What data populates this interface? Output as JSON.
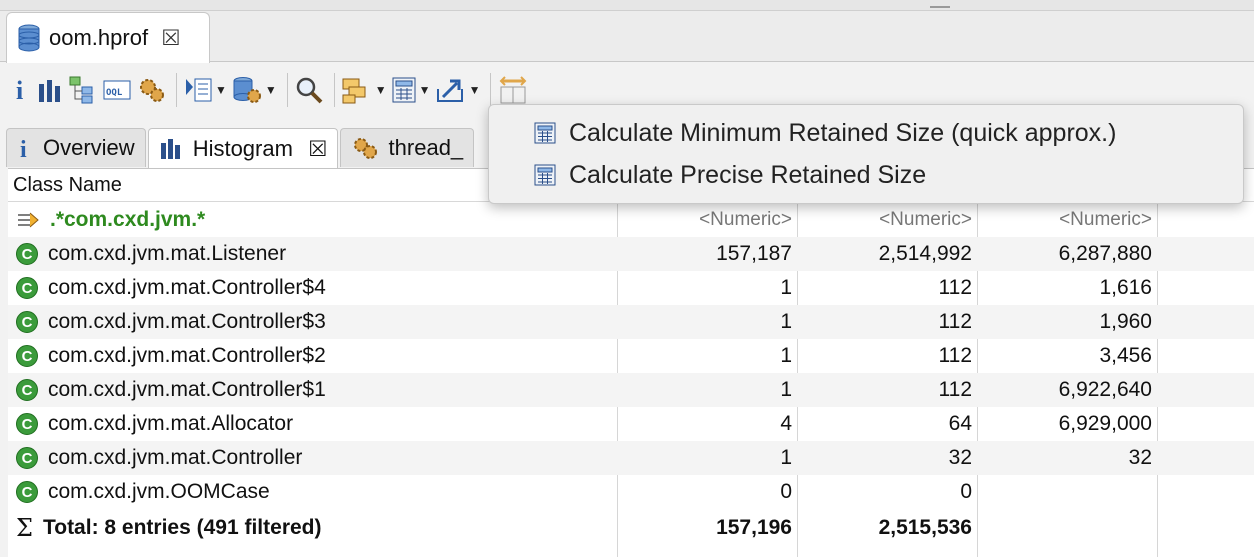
{
  "editor_tab": {
    "title": "oom.hprof"
  },
  "inner_tabs": [
    {
      "label": "Overview"
    },
    {
      "label": "Histogram"
    },
    {
      "label": "thread_"
    }
  ],
  "table": {
    "header": {
      "class_name": "Class Name"
    },
    "filter_row": {
      "name": ".*com.cxd.jvm.*",
      "c1": "<Numeric>",
      "c2": "<Numeric>",
      "c3": "<Numeric>"
    },
    "rows": [
      {
        "name": "com.cxd.jvm.mat.Listener",
        "objects": "157,187",
        "shallow": "2,514,992",
        "retained": "6,287,880"
      },
      {
        "name": "com.cxd.jvm.mat.Controller$4",
        "objects": "1",
        "shallow": "112",
        "retained": "1,616"
      },
      {
        "name": "com.cxd.jvm.mat.Controller$3",
        "objects": "1",
        "shallow": "112",
        "retained": "1,960"
      },
      {
        "name": "com.cxd.jvm.mat.Controller$2",
        "objects": "1",
        "shallow": "112",
        "retained": "3,456"
      },
      {
        "name": "com.cxd.jvm.mat.Controller$1",
        "objects": "1",
        "shallow": "112",
        "retained": "6,922,640"
      },
      {
        "name": "com.cxd.jvm.mat.Allocator",
        "objects": "4",
        "shallow": "64",
        "retained": "6,929,000"
      },
      {
        "name": "com.cxd.jvm.mat.Controller",
        "objects": "1",
        "shallow": "32",
        "retained": "32"
      },
      {
        "name": "com.cxd.jvm.OOMCase",
        "objects": "0",
        "shallow": "0",
        "retained": ""
      }
    ],
    "total": {
      "label": "Total: 8 entries (491 filtered)",
      "objects": "157,196",
      "shallow": "2,515,536"
    }
  },
  "popup_menu": {
    "items": [
      {
        "label": "Calculate Minimum Retained Size (quick approx.)"
      },
      {
        "label": "Calculate Precise Retained Size"
      }
    ]
  },
  "icons": {
    "class_icon_letter": "C",
    "colors": {
      "class_green": "#3b9b3b",
      "filter_green": "#2e8a1f",
      "toolbar_blue": "#2b5fa8"
    }
  }
}
